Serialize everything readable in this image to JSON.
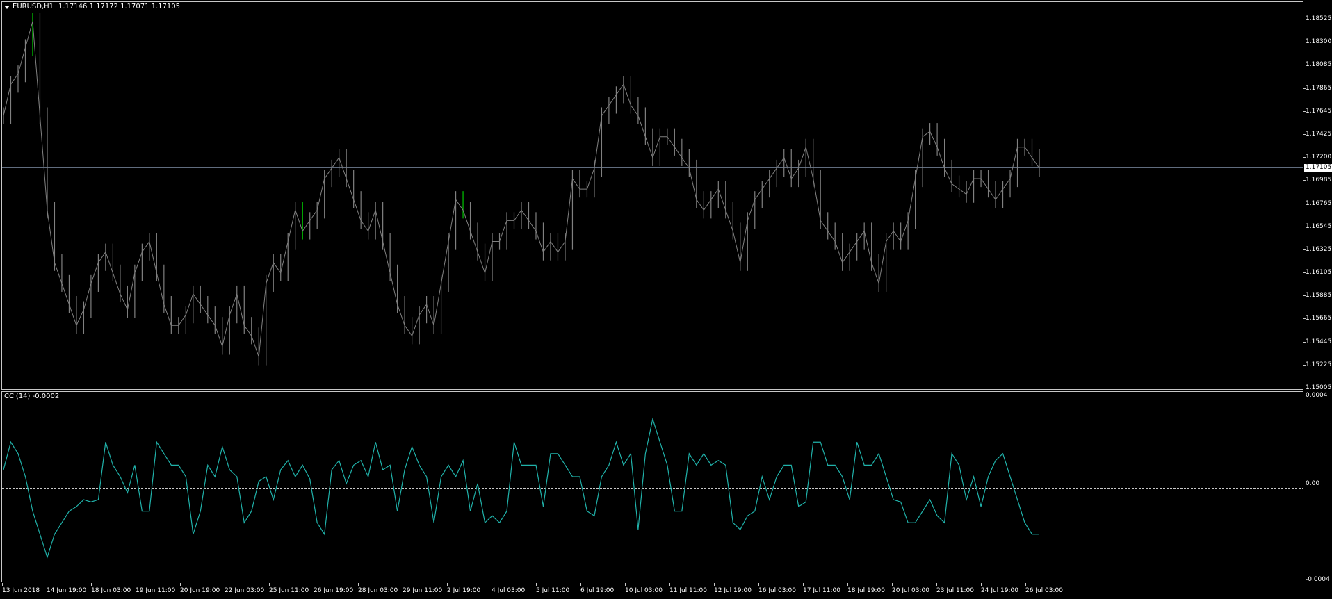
{
  "window": {
    "symbol_title": "EURUSD,H1",
    "ohlc_readout": "1.17146 1.17172 1.17071 1.17105"
  },
  "indicator": {
    "title": "CCI(14) -0.0002",
    "scale_top": "0.0004",
    "scale_zero": "0.00",
    "scale_bottom": "-0.0004"
  },
  "price_axis": {
    "labels": [
      "1.18525",
      "1.18300",
      "1.18085",
      "1.17865",
      "1.17645",
      "1.17425",
      "1.17200",
      "1.16985",
      "1.16765",
      "1.16545",
      "1.16325",
      "1.16105",
      "1.15885",
      "1.15665",
      "1.15445",
      "1.15225",
      "1.15005"
    ],
    "last_price": "1.17105"
  },
  "time_axis": {
    "labels": [
      "13 Jun 2018",
      "14 Jun 19:00",
      "18 Jun 03:00",
      "19 Jun 11:00",
      "20 Jun 19:00",
      "22 Jun 03:00",
      "25 Jun 11:00",
      "26 Jun 19:00",
      "28 Jun 03:00",
      "29 Jun 11:00",
      "2 Jul 19:00",
      "4 Jul 03:00",
      "5 Jul 11:00",
      "6 Jul 19:00",
      "10 Jul 03:00",
      "11 Jul 11:00",
      "12 Jul 19:00",
      "16 Jul 03:00",
      "17 Jul 11:00",
      "18 Jul 19:00",
      "20 Jul 03:00",
      "23 Jul 11:00",
      "24 Jul 19:00",
      "26 Jul 03:00"
    ]
  },
  "colors": {
    "background": "#000000",
    "bars": "#808080",
    "bull_accent": "#00c800",
    "cci_line": "#20b2aa",
    "grid_line": "#8090a8"
  },
  "chart_data": [
    {
      "type": "line",
      "title": "EURUSD,H1",
      "series": [
        {
          "name": "EURUSD,H1",
          "values": [
            1.176,
            1.179,
            1.18,
            1.1825,
            1.185,
            1.176,
            1.167,
            1.162,
            1.16,
            1.158,
            1.156,
            1.1575,
            1.16,
            1.162,
            1.163,
            1.161,
            1.159,
            1.1575,
            1.161,
            1.163,
            1.164,
            1.161,
            1.158,
            1.156,
            1.156,
            1.157,
            1.159,
            1.158,
            1.157,
            1.156,
            1.154,
            1.157,
            1.159,
            1.156,
            1.155,
            1.153,
            1.16,
            1.162,
            1.161,
            1.164,
            1.167,
            1.165,
            1.166,
            1.167,
            1.17,
            1.171,
            1.172,
            1.17,
            1.168,
            1.166,
            1.165,
            1.167,
            1.164,
            1.161,
            1.158,
            1.156,
            1.155,
            1.157,
            1.158,
            1.156,
            1.16,
            1.164,
            1.168,
            1.167,
            1.165,
            1.163,
            1.161,
            1.164,
            1.164,
            1.166,
            1.166,
            1.167,
            1.166,
            1.165,
            1.163,
            1.164,
            1.163,
            1.164,
            1.17,
            1.169,
            1.169,
            1.171,
            1.176,
            1.177,
            1.178,
            1.179,
            1.177,
            1.176,
            1.174,
            1.172,
            1.174,
            1.174,
            1.173,
            1.172,
            1.171,
            1.168,
            1.167,
            1.168,
            1.169,
            1.167,
            1.165,
            1.162,
            1.166,
            1.168,
            1.169,
            1.17,
            1.171,
            1.172,
            1.17,
            1.171,
            1.173,
            1.17,
            1.166,
            1.165,
            1.164,
            1.162,
            1.163,
            1.164,
            1.165,
            1.162,
            1.16,
            1.164,
            1.165,
            1.164,
            1.166,
            1.17,
            1.174,
            1.1745,
            1.173,
            1.171,
            1.1695,
            1.169,
            1.1685,
            1.17,
            1.17,
            1.169,
            1.168,
            1.169,
            1.17,
            1.173,
            1.173,
            1.172,
            1.171
          ]
        }
      ],
      "xlabel": "",
      "ylabel": "",
      "ylim": [
        1.15005,
        1.18525
      ],
      "xlabels": [
        "13 Jun 2018",
        "14 Jun 19:00",
        "18 Jun 03:00",
        "19 Jun 11:00",
        "20 Jun 19:00",
        "22 Jun 03:00",
        "25 Jun 11:00",
        "26 Jun 19:00",
        "28 Jun 03:00",
        "29 Jun 11:00",
        "2 Jul 19:00",
        "4 Jul 03:00",
        "5 Jul 11:00",
        "6 Jul 19:00",
        "10 Jul 03:00",
        "11 Jul 11:00",
        "12 Jul 19:00",
        "16 Jul 03:00",
        "17 Jul 11:00",
        "18 Jul 19:00",
        "20 Jul 03:00",
        "23 Jul 11:00",
        "24 Jul 19:00",
        "26 Jul 03:00"
      ],
      "hline": 1.17105,
      "grid": false
    },
    {
      "type": "line",
      "title": "CCI(14) -0.0002",
      "series": [
        {
          "name": "CCI(14)",
          "values": [
            8e-05,
            0.0002,
            0.00015,
            5e-05,
            -0.0001,
            -0.0002,
            -0.0003,
            -0.0002,
            -0.00015,
            -0.0001,
            -8e-05,
            -5e-05,
            -6e-05,
            -5e-05,
            0.0002,
            0.0001,
            5e-05,
            -2e-05,
            0.0001,
            -0.0001,
            -0.0001,
            0.0002,
            0.00015,
            0.0001,
            0.0001,
            5e-05,
            -0.0002,
            -0.0001,
            0.0001,
            5e-05,
            0.00018,
            8e-05,
            5e-05,
            -0.00015,
            -0.0001,
            3e-05,
            5e-05,
            -5e-05,
            8e-05,
            0.00012,
            5e-05,
            0.0001,
            4e-05,
            -0.00015,
            -0.0002,
            8e-05,
            0.00012,
            2e-05,
            0.0001,
            0.00012,
            5e-05,
            0.0002,
            8e-05,
            0.0001,
            -0.0001,
            8e-05,
            0.00018,
            0.0001,
            5e-05,
            -0.00015,
            5e-05,
            0.0001,
            5e-05,
            0.00012,
            -0.0001,
            2e-05,
            -0.00015,
            -0.00012,
            -0.00015,
            -0.0001,
            0.0002,
            0.0001,
            0.0001,
            0.0001,
            -8e-05,
            0.00015,
            0.00015,
            0.0001,
            5e-05,
            5e-05,
            -0.0001,
            -0.00012,
            5e-05,
            0.0001,
            0.0002,
            0.0001,
            0.00015,
            -0.00018,
            0.00015,
            0.0003,
            0.0002,
            0.0001,
            -0.0001,
            -0.0001,
            0.00015,
            0.0001,
            0.00015,
            0.0001,
            0.00012,
            0.0001,
            -0.00015,
            -0.00018,
            -0.00012,
            -0.0001,
            5e-05,
            -5e-05,
            5e-05,
            0.0001,
            0.0001,
            -8e-05,
            -6e-05,
            0.0002,
            0.0002,
            0.0001,
            0.0001,
            5e-05,
            -5e-05,
            0.0002,
            0.0001,
            0.0001,
            0.00015,
            5e-05,
            -5e-05,
            -6e-05,
            -0.00015,
            -0.00015,
            -0.0001,
            -5e-05,
            -0.00012,
            -0.00015,
            0.00015,
            0.0001,
            -5e-05,
            5e-05,
            -8e-05,
            5e-05,
            0.00012,
            0.00015,
            5e-05,
            -5e-05,
            -0.00015,
            -0.0002,
            -0.0002
          ]
        }
      ],
      "xlabel": "",
      "ylabel": "",
      "ylim": [
        -0.0004,
        0.0004
      ],
      "grid": false
    }
  ]
}
